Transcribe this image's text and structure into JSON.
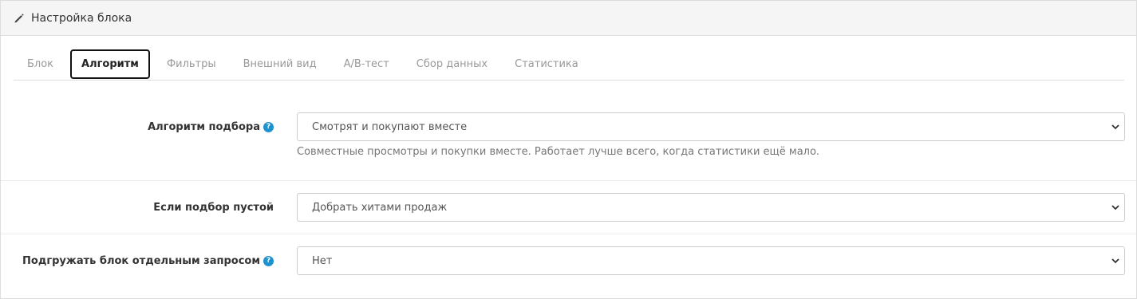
{
  "panel": {
    "title": "Настройка блока"
  },
  "tabs": [
    {
      "label": "Блок",
      "active": false
    },
    {
      "label": "Алгоритм",
      "active": true
    },
    {
      "label": "Фильтры",
      "active": false
    },
    {
      "label": "Внешний вид",
      "active": false
    },
    {
      "label": "A/B-тест",
      "active": false
    },
    {
      "label": "Сбор данных",
      "active": false
    },
    {
      "label": "Статистика",
      "active": false
    }
  ],
  "fields": {
    "algorithm": {
      "label": "Алгоритм подбора",
      "value": "Смотрят и покупают вместе",
      "help": "Совместные просмотры и покупки вместе. Работает лучше всего, когда статистики ещё мало."
    },
    "empty_fallback": {
      "label": "Если подбор пустой",
      "value": "Добрать хитами продаж"
    },
    "separate_request": {
      "label": "Подгружать блок отдельным запросом",
      "value": "Нет"
    }
  },
  "icons": {
    "header": "pencil-icon",
    "help": "question-circle-icon",
    "select": "chevron-down-icon"
  },
  "colors": {
    "help_icon": "#1e91cf",
    "heading_bg": "#f5f5f5"
  }
}
